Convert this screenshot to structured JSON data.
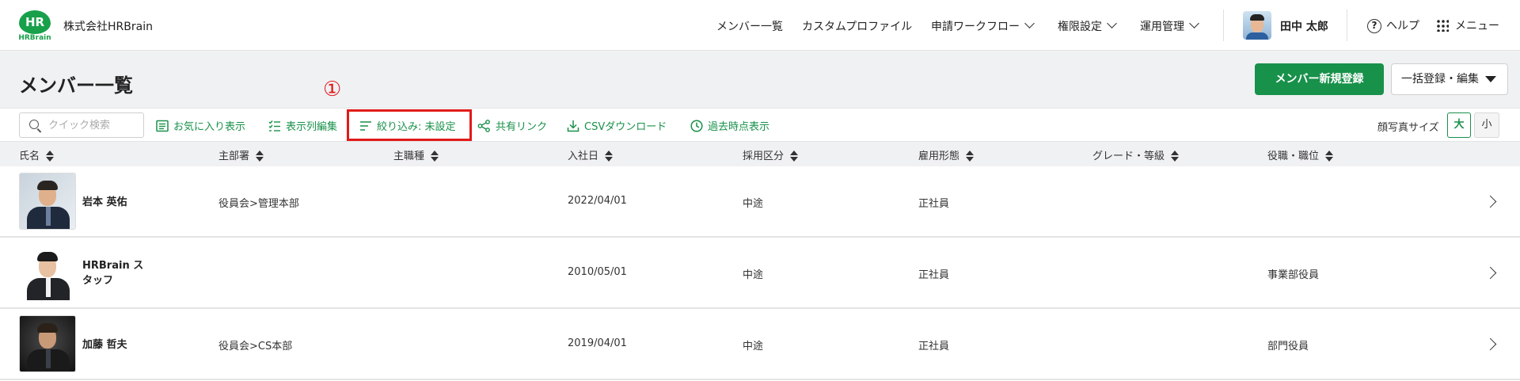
{
  "header": {
    "logo_text": "HR",
    "logo_subtext": "HRBrain",
    "company": "株式会社HRBrain",
    "nav": [
      {
        "label": "メンバー一覧"
      },
      {
        "label": "カスタムプロファイル"
      },
      {
        "label": "申請ワークフロー"
      },
      {
        "label": "権限設定"
      },
      {
        "label": "運用管理"
      }
    ],
    "user_name": "田中 太郎",
    "help_label": "ヘルプ",
    "menu_label": "メニュー"
  },
  "page": {
    "title": "メンバー一覧",
    "primary_button": "メンバー新規登録",
    "secondary_button": "一括登録・編集",
    "annotation": "①"
  },
  "toolbar": {
    "search_placeholder": "クイック検索",
    "favorites": "お気に入り表示",
    "columns": "表示列編集",
    "filter": "絞り込み: 未設定",
    "share": "共有リンク",
    "csv": "CSVダウンロード",
    "history": "過去時点表示",
    "photo_size_label": "顔写真サイズ",
    "size_large": "大",
    "size_small": "小"
  },
  "table": {
    "headers": [
      "氏名",
      "主部署",
      "主職種",
      "入社日",
      "採用区分",
      "雇用形態",
      "グレード・等級",
      "役職・職位"
    ],
    "rows": [
      {
        "name": "岩本 英佑",
        "department": "役員会>管理本部",
        "job_type": "",
        "join_date": "2022/04/01",
        "hiring": "中途",
        "employment": "正社員",
        "grade": "",
        "position": ""
      },
      {
        "name": "HRBrain スタッフ",
        "department": "",
        "job_type": "",
        "join_date": "2010/05/01",
        "hiring": "中途",
        "employment": "正社員",
        "grade": "",
        "position": "事業部役員"
      },
      {
        "name": "加藤 哲夫",
        "department": "役員会>CS本部",
        "job_type": "",
        "join_date": "2019/04/01",
        "hiring": "中途",
        "employment": "正社員",
        "grade": "",
        "position": "部門役員"
      }
    ]
  },
  "colors": {
    "brand": "#18914a",
    "annotation": "#e21a1a",
    "header_bg": "#f0f1f3"
  },
  "icons": [
    "search-icon",
    "list-icon",
    "columns-icon",
    "filter-icon",
    "share-icon",
    "download-icon",
    "clock-icon",
    "help-icon",
    "grid-icon",
    "chevron-down-icon",
    "chevron-right-icon",
    "sort-icon"
  ]
}
